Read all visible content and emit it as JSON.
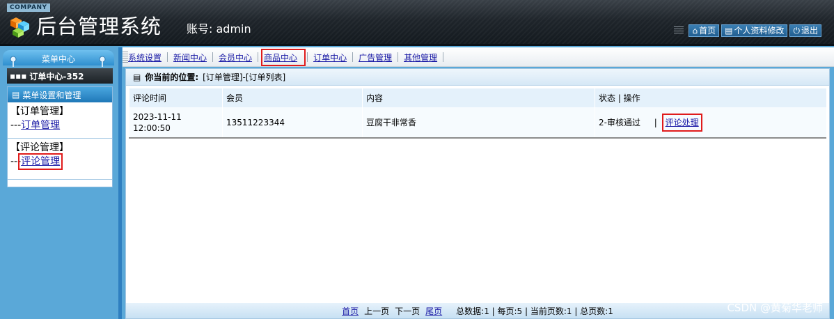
{
  "header": {
    "company": "COMPANY",
    "title": "后台管理系统",
    "account_label": "账号:",
    "account_value": "admin",
    "buttons": [
      {
        "label": "首页",
        "icon": "home-icon"
      },
      {
        "label": "个人资料修改",
        "icon": "profile-icon"
      },
      {
        "label": "退出",
        "icon": "power-icon"
      }
    ]
  },
  "sidebar": {
    "top_label": "菜单中心",
    "order_bar": "订单中心-352",
    "panel_title": "菜单设置和管理",
    "groups": [
      {
        "title": "【订单管理】",
        "prefix": "---",
        "link": "订单管理"
      },
      {
        "title": "【评论管理】",
        "prefix": "---",
        "link": "评论管理"
      }
    ]
  },
  "nav": {
    "items": [
      "系统设置",
      "新闻中心",
      "会员中心",
      "商品中心",
      "订单中心",
      "广告管理",
      "其他管理"
    ]
  },
  "breadcrumb": {
    "label": "你当前的位置:",
    "path": "[订单管理]-[订单列表]"
  },
  "table": {
    "headers": [
      "评论时间",
      "会员",
      "内容",
      "状态 | 操作"
    ],
    "rows": [
      {
        "time": "2023-11-11 12:00:50",
        "member": "13511223344",
        "content": "豆腐干非常香",
        "status": "2-审核通过",
        "sep": "|",
        "action": "评论处理"
      }
    ]
  },
  "pager": {
    "first": "首页",
    "prev": "上一页",
    "next": "下一页",
    "last": "尾页",
    "stats": "总数据:1 | 每页:5 | 当前页数:1 | 总页数:1"
  },
  "watermark": "CSDN @黄菊华老师",
  "colors": {
    "accent": "#2f8fcf",
    "highlight": "#e01b1b",
    "header": "#1f252b"
  }
}
